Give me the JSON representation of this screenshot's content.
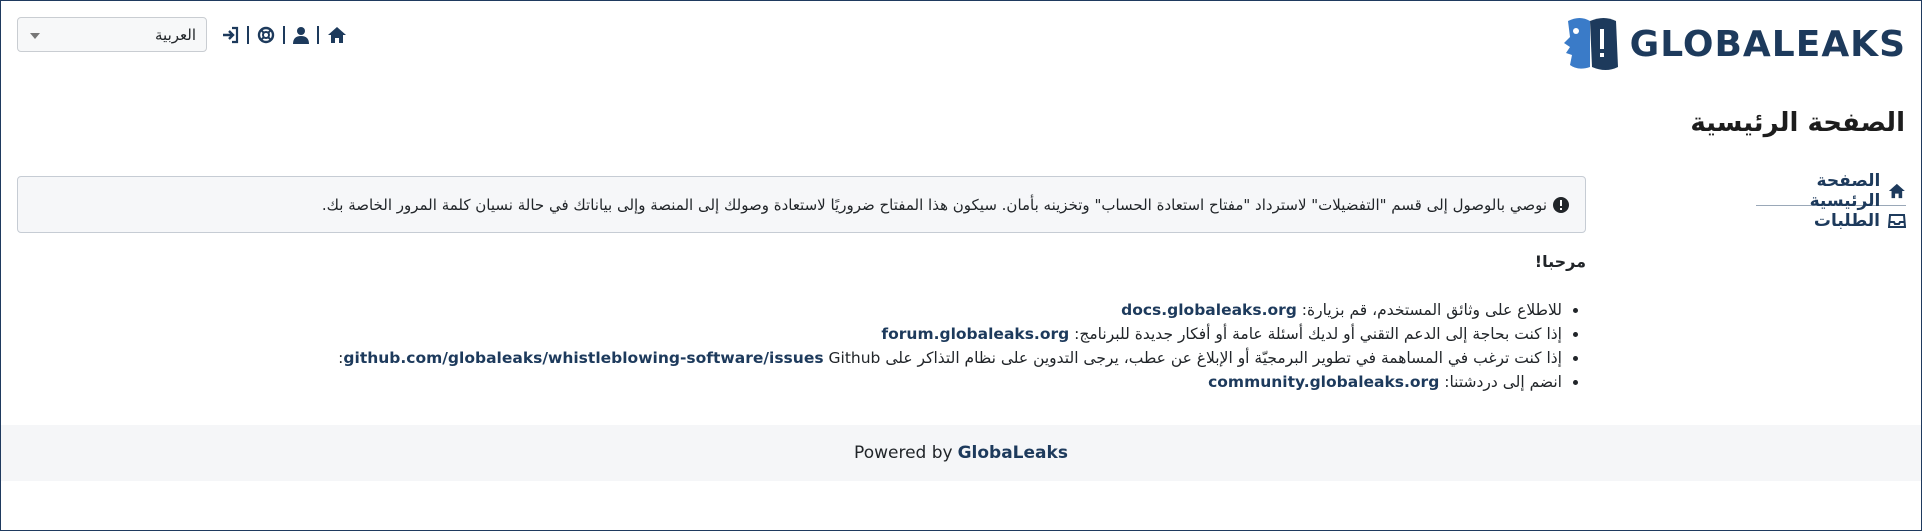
{
  "brand": {
    "name": "GLOBALEAKS",
    "color": "#1d3a5c",
    "accent": "#3a7bc8"
  },
  "toolbar": {
    "language": "العربية",
    "icons": [
      "home-icon",
      "user-icon",
      "support-icon",
      "logout-icon"
    ]
  },
  "page": {
    "title": "الصفحة الرئيسية"
  },
  "sidebar": {
    "items": [
      {
        "label": "الصفحة الرئيسية",
        "icon": "home-icon",
        "active": true
      },
      {
        "label": "الطلبات",
        "icon": "inbox-icon",
        "active": false
      }
    ]
  },
  "alert": {
    "icon": "exclamation-circle-icon",
    "text": "نوصي بالوصول إلى قسم \"التفضيلات\" لاسترداد \"مفتاح استعادة الحساب\" وتخزينه بأمان. سيكون هذا المفتاح ضروريًا لاستعادة وصولك إلى المنصة وإلى بياناتك في حالة نسيان كلمة المرور الخاصة بك."
  },
  "welcome": "مرحبا!",
  "links": [
    {
      "prefix": "للاطلاع على وثائق المستخدم، قم بزيارة:",
      "link": "docs.globaleaks.org",
      "suffix": ""
    },
    {
      "prefix": "إذا كنت بحاجة إلى الدعم التقني أو لديك أسئلة عامة أو أفكار جديدة للبرنامج:",
      "link": "forum.globaleaks.org",
      "suffix": ""
    },
    {
      "prefix": "إذا كنت ترغب في المساهمة في تطوير البرمجيّة أو الإبلاغ عن عطب، يرجى التدوين على نظام التذاكر على",
      "link": "github.com/globaleaks/whistleblowing-software/issues",
      "suffix": "Github:"
    },
    {
      "prefix": "انضم إلى دردشتنا:",
      "link": "community.globaleaks.org",
      "suffix": ""
    }
  ],
  "footer": {
    "text": "Powered by",
    "link": "GlobaLeaks"
  }
}
